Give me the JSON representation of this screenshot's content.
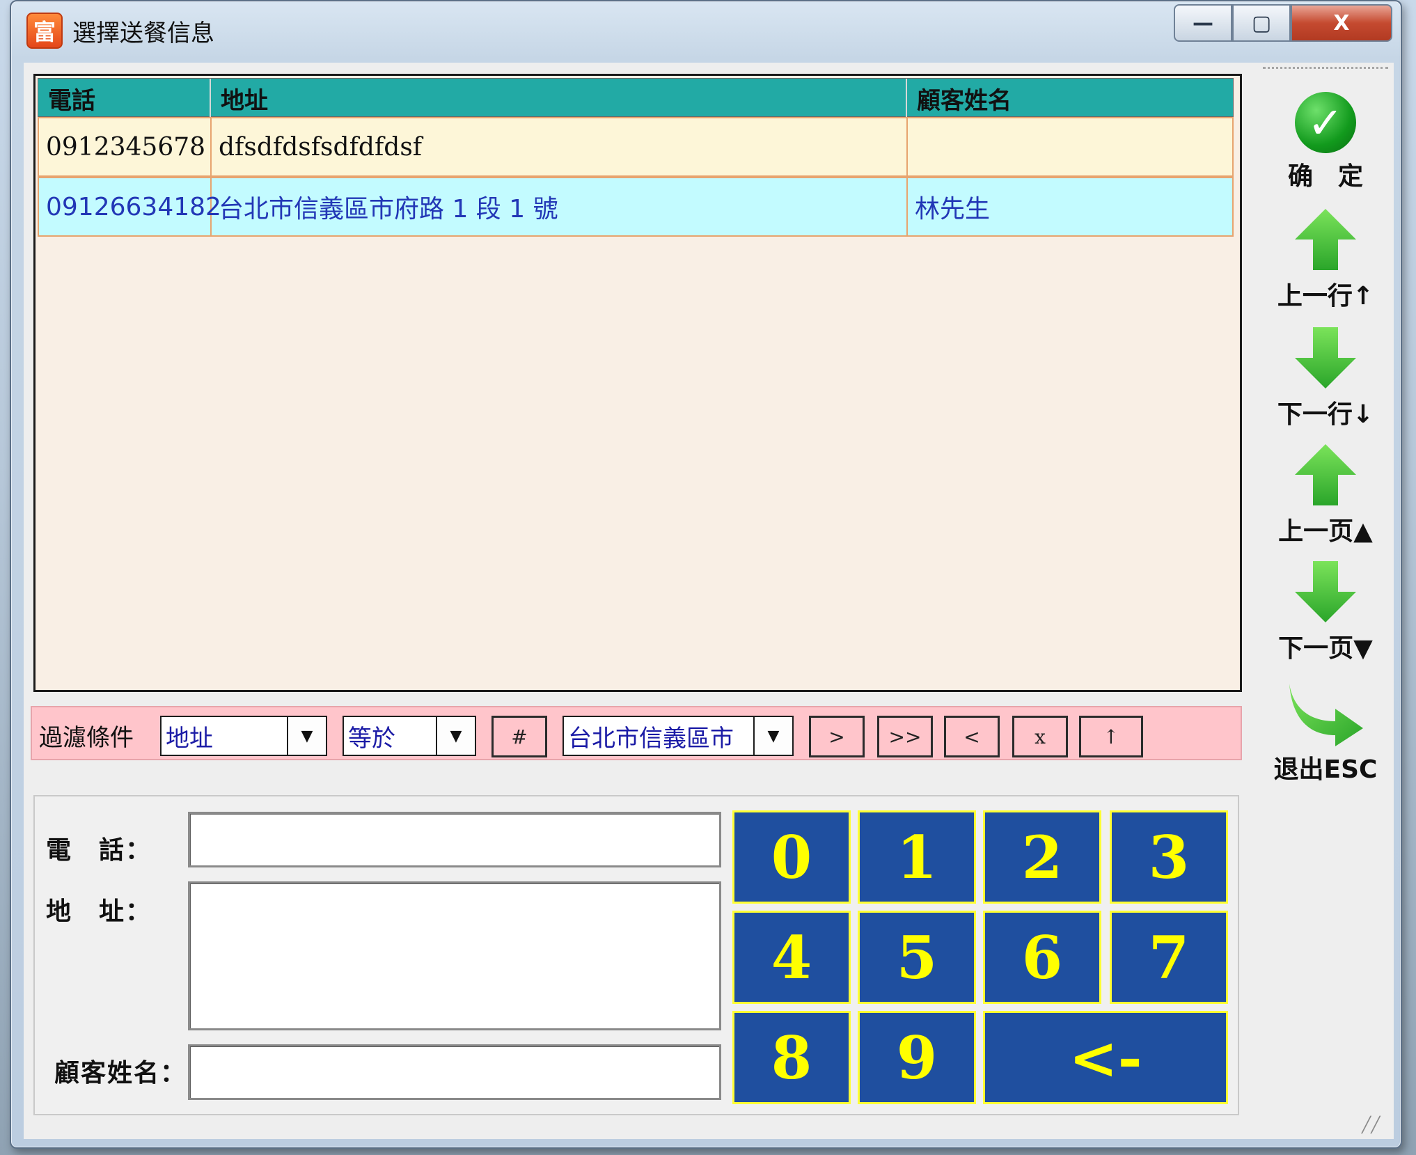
{
  "window": {
    "title": "選擇送餐信息",
    "app_icon_glyph": "富",
    "controls": {
      "minimize": "—",
      "maximize": "▢",
      "close": "X"
    }
  },
  "grid": {
    "columns": [
      "電話",
      "地址",
      "顧客姓名"
    ],
    "rows": [
      {
        "phone": "0912345678",
        "address": "dfsdfdsfsdfdfdsf",
        "name": ""
      },
      {
        "phone": "09126634182",
        "address": "台北市信義區市府路 1 段 1 號",
        "name": "林先生"
      }
    ]
  },
  "filter": {
    "label": "過濾條件",
    "field": "地址",
    "operator": "等於",
    "hash_button": "#",
    "value": "台北市信義區市",
    "buttons": [
      ">",
      ">>",
      "<",
      "x",
      "↑"
    ]
  },
  "form": {
    "phone_label": "電　話：",
    "address_label": "地　址：",
    "name_label": "顧客姓名：",
    "phone_value": "",
    "address_value": "",
    "name_value": ""
  },
  "numpad": {
    "keys": [
      "0",
      "1",
      "2",
      "3",
      "4",
      "5",
      "6",
      "7",
      "8",
      "9"
    ],
    "backspace": "<-"
  },
  "toolbar": {
    "confirm": "确　定",
    "prev_row": "上一行↑",
    "next_row": "下一行↓",
    "prev_page": "上一页▲",
    "next_page": "下一页▼",
    "exit": "退出ESC"
  },
  "colors": {
    "header_teal": "#22aaa5",
    "row_cream": "#fdf6d8",
    "row_cyan": "#c3fbff",
    "filter_pink": "#ffc5cb",
    "key_blue": "#1f4f9f",
    "key_yellow": "#ffff00",
    "arrow_green": "#39c12e"
  },
  "icons": {
    "confirm": "check-circle-icon",
    "up": "arrow-up-icon",
    "down": "arrow-down-icon",
    "exit": "curved-arrow-right-icon"
  }
}
